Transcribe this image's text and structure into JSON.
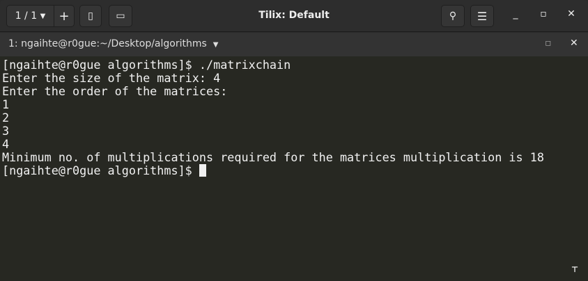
{
  "header": {
    "session_label": "1 / 1",
    "title": "Tilix: Default"
  },
  "tab": {
    "label": "1: ngaihte@r0gue:~/Desktop/algorithms"
  },
  "terminal": {
    "lines": [
      "[ngaihte@r0gue algorithms]$ ./matrixchain",
      "Enter the size of the matrix: 4",
      "Enter the order of the matrices:",
      "1",
      "2",
      "3",
      "4",
      "Minimum no. of multiplications required for the matrices multiplication is 18"
    ],
    "prompt": "[ngaihte@r0gue algorithms]$ "
  },
  "colors": {
    "terminal_bg": "#272822",
    "header_bg": "#2d2d2d"
  }
}
